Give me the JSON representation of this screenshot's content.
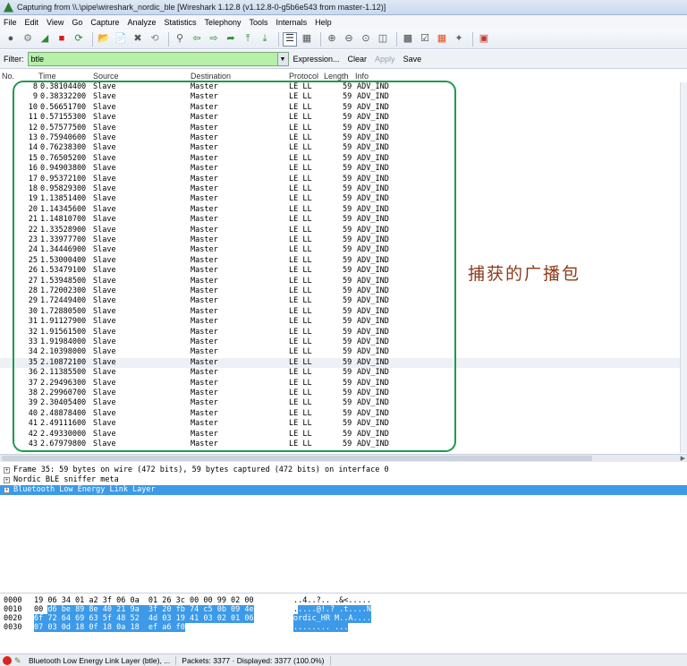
{
  "window": {
    "title": "Capturing from \\\\.\\pipe\\wireshark_nordic_ble   [Wireshark 1.12.8  (v1.12.8-0-g5b6e543 from master-1.12)]"
  },
  "menu": [
    "File",
    "Edit",
    "View",
    "Go",
    "Capture",
    "Analyze",
    "Statistics",
    "Telephony",
    "Tools",
    "Internals",
    "Help"
  ],
  "filter": {
    "label": "Filter:",
    "value": "btle",
    "expression": "Expression...",
    "clear": "Clear",
    "apply": "Apply",
    "save": "Save"
  },
  "columns": {
    "no": "No.",
    "time": "Time",
    "source": "Source",
    "destination": "Destination",
    "protocol": "Protocol",
    "length": "Length",
    "info": "Info"
  },
  "packets": [
    [
      "8",
      "0.38104400",
      "Slave",
      "Master",
      "LE LL",
      "59",
      "ADV_IND"
    ],
    [
      "9",
      "0.38332200",
      "Slave",
      "Master",
      "LE LL",
      "59",
      "ADV_IND"
    ],
    [
      "10",
      "0.56651700",
      "Slave",
      "Master",
      "LE LL",
      "59",
      "ADV_IND"
    ],
    [
      "11",
      "0.57155300",
      "Slave",
      "Master",
      "LE LL",
      "59",
      "ADV_IND"
    ],
    [
      "12",
      "0.57577500",
      "Slave",
      "Master",
      "LE LL",
      "59",
      "ADV_IND"
    ],
    [
      "13",
      "0.75940600",
      "Slave",
      "Master",
      "LE LL",
      "59",
      "ADV_IND"
    ],
    [
      "14",
      "0.76238300",
      "Slave",
      "Master",
      "LE LL",
      "59",
      "ADV_IND"
    ],
    [
      "15",
      "0.76505200",
      "Slave",
      "Master",
      "LE LL",
      "59",
      "ADV_IND"
    ],
    [
      "16",
      "0.94903800",
      "Slave",
      "Master",
      "LE LL",
      "59",
      "ADV_IND"
    ],
    [
      "17",
      "0.95372100",
      "Slave",
      "Master",
      "LE LL",
      "59",
      "ADV_IND"
    ],
    [
      "18",
      "0.95829300",
      "Slave",
      "Master",
      "LE LL",
      "59",
      "ADV_IND"
    ],
    [
      "19",
      "1.13851400",
      "Slave",
      "Master",
      "LE LL",
      "59",
      "ADV_IND"
    ],
    [
      "20",
      "1.14345600",
      "Slave",
      "Master",
      "LE LL",
      "59",
      "ADV_IND"
    ],
    [
      "21",
      "1.14810700",
      "Slave",
      "Master",
      "LE LL",
      "59",
      "ADV_IND"
    ],
    [
      "22",
      "1.33528900",
      "Slave",
      "Master",
      "LE LL",
      "59",
      "ADV_IND"
    ],
    [
      "23",
      "1.33977700",
      "Slave",
      "Master",
      "LE LL",
      "59",
      "ADV_IND"
    ],
    [
      "24",
      "1.34446900",
      "Slave",
      "Master",
      "LE LL",
      "59",
      "ADV_IND"
    ],
    [
      "25",
      "1.53000400",
      "Slave",
      "Master",
      "LE LL",
      "59",
      "ADV_IND"
    ],
    [
      "26",
      "1.53479100",
      "Slave",
      "Master",
      "LE LL",
      "59",
      "ADV_IND"
    ],
    [
      "27",
      "1.53948500",
      "Slave",
      "Master",
      "LE LL",
      "59",
      "ADV_IND"
    ],
    [
      "28",
      "1.72002300",
      "Slave",
      "Master",
      "LE LL",
      "59",
      "ADV_IND"
    ],
    [
      "29",
      "1.72449400",
      "Slave",
      "Master",
      "LE LL",
      "59",
      "ADV_IND"
    ],
    [
      "30",
      "1.72880500",
      "Slave",
      "Master",
      "LE LL",
      "59",
      "ADV_IND"
    ],
    [
      "31",
      "1.91127900",
      "Slave",
      "Master",
      "LE LL",
      "59",
      "ADV_IND"
    ],
    [
      "32",
      "1.91561500",
      "Slave",
      "Master",
      "LE LL",
      "59",
      "ADV_IND"
    ],
    [
      "33",
      "1.91984000",
      "Slave",
      "Master",
      "LE LL",
      "59",
      "ADV_IND"
    ],
    [
      "34",
      "2.10398000",
      "Slave",
      "Master",
      "LE LL",
      "59",
      "ADV_IND"
    ],
    [
      "35",
      "2.10872100",
      "Slave",
      "Master",
      "LE LL",
      "59",
      "ADV_IND"
    ],
    [
      "36",
      "2.11385500",
      "Slave",
      "Master",
      "LE LL",
      "59",
      "ADV_IND"
    ],
    [
      "37",
      "2.29496300",
      "Slave",
      "Master",
      "LE LL",
      "59",
      "ADV_IND"
    ],
    [
      "38",
      "2.29960700",
      "Slave",
      "Master",
      "LE LL",
      "59",
      "ADV_IND"
    ],
    [
      "39",
      "2.30405400",
      "Slave",
      "Master",
      "LE LL",
      "59",
      "ADV_IND"
    ],
    [
      "40",
      "2.48878400",
      "Slave",
      "Master",
      "LE LL",
      "59",
      "ADV_IND"
    ],
    [
      "41",
      "2.49111600",
      "Slave",
      "Master",
      "LE LL",
      "59",
      "ADV_IND"
    ],
    [
      "42",
      "2.49330000",
      "Slave",
      "Master",
      "LE LL",
      "59",
      "ADV_IND"
    ],
    [
      "43",
      "2.67979800",
      "Slave",
      "Master",
      "LE LL",
      "59",
      "ADV_IND"
    ]
  ],
  "selected_packet": "35",
  "annotation": "捕获的广播包",
  "details": [
    {
      "text": "Frame 35: 59 bytes on wire (472 bits), 59 bytes captured (472 bits) on interface 0",
      "selected": false
    },
    {
      "text": "Nordic BLE sniffer meta",
      "selected": false
    },
    {
      "text": "Bluetooth Low Energy Link Layer",
      "selected": true
    }
  ],
  "bytes": [
    {
      "offset": "0000",
      "hex_plain": "19 06 34 01 a2 3f 06 0a  01 26 3c 00 00 99 02 00",
      "hex_sel": "",
      "ascii_plain": "..4..?.. .&<.....",
      "ascii_sel": ""
    },
    {
      "offset": "0010",
      "hex_plain": "00 ",
      "hex_sel": "d6 be 89 8e 40 21 9a  3f 20 fb 74 c5 0b 09 4e",
      "ascii_plain": ".",
      "ascii_sel": "....@!.? .t....N"
    },
    {
      "offset": "0020",
      "hex_plain": "",
      "hex_sel": "6f 72 64 69 63 5f 48 52  4d 03 19 41 03 02 01 06",
      "ascii_plain": "",
      "ascii_sel": "ordic_HR M..A...."
    },
    {
      "offset": "0030",
      "hex_plain": "",
      "hex_sel": "07 03 0d 18 0f 18 0a 18  ef a6 f0",
      "ascii_plain": "",
      "ascii_sel": "........ ..."
    }
  ],
  "status": {
    "field": "Bluetooth Low Energy Link Layer (btle), ...",
    "packets": "Packets: 3377 · Displayed: 3377 (100.0%)"
  },
  "colors": {
    "accent_green": "#1f9a4c",
    "selection_blue": "#3c9ae8",
    "filter_green": "#b6f0a9",
    "annotation": "#8b3a1a"
  }
}
